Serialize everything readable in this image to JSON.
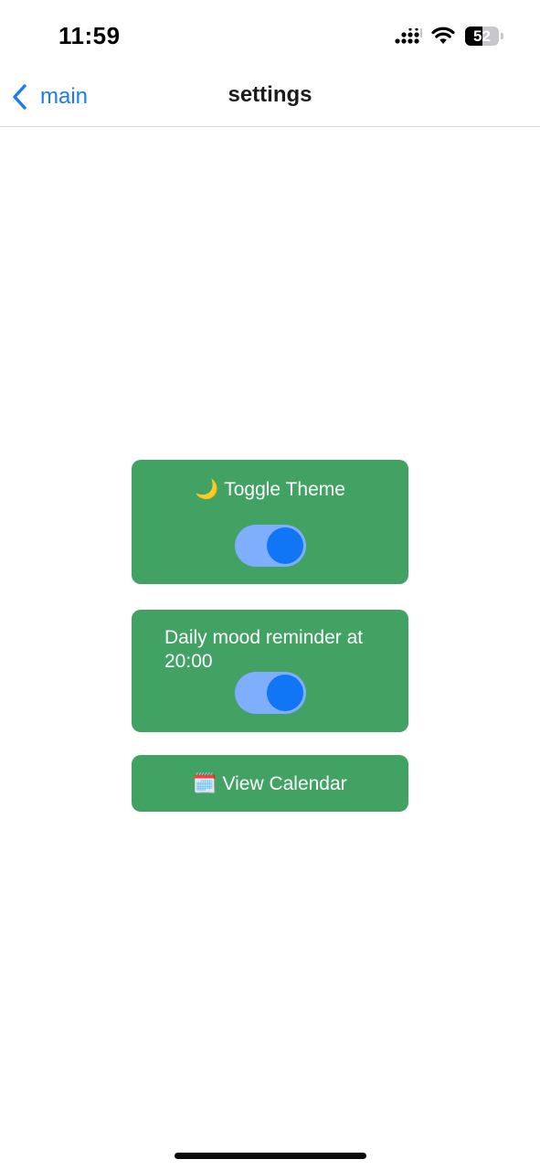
{
  "status_bar": {
    "time": "11:59",
    "battery_percent": "52",
    "battery_level": 0.52,
    "icons": [
      "cellular-signal-icon",
      "wifi-icon",
      "battery-icon"
    ]
  },
  "nav": {
    "back_label": "main",
    "title": "settings",
    "accent_color": "#1a7cf0"
  },
  "settings": {
    "card_color": "#41a264",
    "theme": {
      "emoji": "🌙",
      "label": "Toggle Theme",
      "toggle_on": true
    },
    "reminder": {
      "label": "Daily mood reminder at 20:00",
      "toggle_on": true
    },
    "calendar": {
      "emoji": "🗓️",
      "label": "View Calendar"
    }
  },
  "colors": {
    "toggle_track": "#7eaefc",
    "toggle_knob": "#1076f6"
  }
}
